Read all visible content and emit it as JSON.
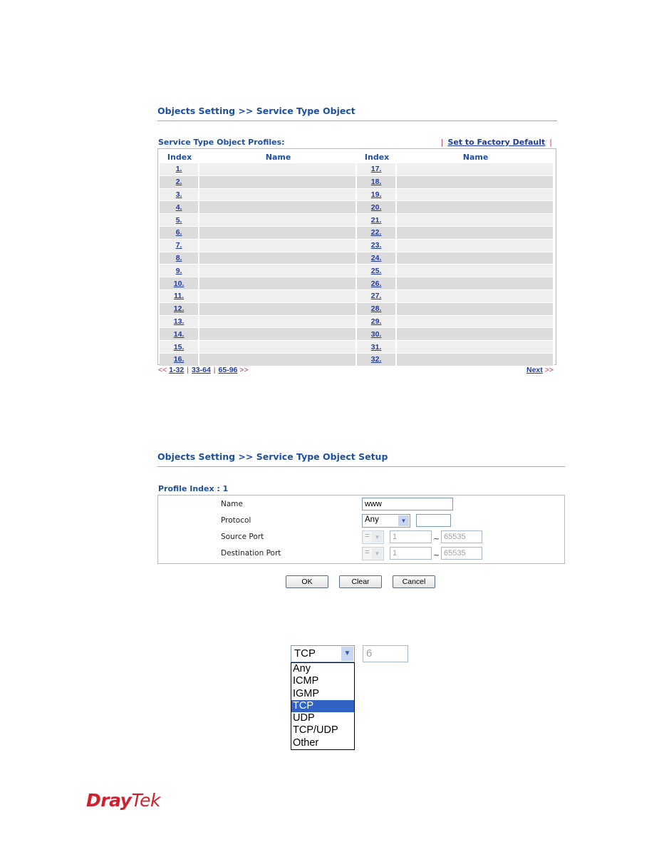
{
  "profiles_page": {
    "title": "Objects Setting >> Service Type Object",
    "subtitle": "Service Type Object Profiles:",
    "factory_default_label": "Set to Factory Default",
    "headers": {
      "index": "Index",
      "name": "Name"
    },
    "rows": [
      {
        "left": {
          "index": "1.",
          "name": ""
        },
        "right": {
          "index": "17.",
          "name": ""
        }
      },
      {
        "left": {
          "index": "2.",
          "name": ""
        },
        "right": {
          "index": "18.",
          "name": ""
        }
      },
      {
        "left": {
          "index": "3.",
          "name": ""
        },
        "right": {
          "index": "19.",
          "name": ""
        }
      },
      {
        "left": {
          "index": "4.",
          "name": ""
        },
        "right": {
          "index": "20.",
          "name": ""
        }
      },
      {
        "left": {
          "index": "5.",
          "name": ""
        },
        "right": {
          "index": "21.",
          "name": ""
        }
      },
      {
        "left": {
          "index": "6.",
          "name": ""
        },
        "right": {
          "index": "22.",
          "name": ""
        }
      },
      {
        "left": {
          "index": "7.",
          "name": ""
        },
        "right": {
          "index": "23.",
          "name": ""
        }
      },
      {
        "left": {
          "index": "8.",
          "name": ""
        },
        "right": {
          "index": "24.",
          "name": ""
        }
      },
      {
        "left": {
          "index": "9.",
          "name": ""
        },
        "right": {
          "index": "25.",
          "name": ""
        }
      },
      {
        "left": {
          "index": "10.",
          "name": ""
        },
        "right": {
          "index": "26.",
          "name": ""
        }
      },
      {
        "left": {
          "index": "11.",
          "name": ""
        },
        "right": {
          "index": "27.",
          "name": ""
        }
      },
      {
        "left": {
          "index": "12.",
          "name": ""
        },
        "right": {
          "index": "28.",
          "name": ""
        }
      },
      {
        "left": {
          "index": "13.",
          "name": ""
        },
        "right": {
          "index": "29.",
          "name": ""
        }
      },
      {
        "left": {
          "index": "14.",
          "name": ""
        },
        "right": {
          "index": "30.",
          "name": ""
        }
      },
      {
        "left": {
          "index": "15.",
          "name": ""
        },
        "right": {
          "index": "31.",
          "name": ""
        }
      },
      {
        "left": {
          "index": "16.",
          "name": ""
        },
        "right": {
          "index": "32.",
          "name": ""
        }
      }
    ],
    "pager": {
      "prev_arrows": "<<",
      "pages": [
        "1-32",
        "33-64",
        "65-96"
      ],
      "next_arrows": ">>",
      "next_label": "Next",
      "separator": "|"
    }
  },
  "setup_page": {
    "title": "Objects Setting >> Service Type Object Setup",
    "profile_index_label": "Profile Index : 1",
    "fields": {
      "name_label": "Name",
      "name_value": "www",
      "protocol_label": "Protocol",
      "protocol_value": "Any",
      "protocol_number": "",
      "source_port_label": "Source Port",
      "source_op": "=",
      "source_start": "1",
      "source_end": "65535",
      "dest_port_label": "Destination Port",
      "dest_op": "=",
      "dest_start": "1",
      "dest_end": "65535",
      "range_sep": "~"
    },
    "buttons": {
      "ok": "OK",
      "clear": "Clear",
      "cancel": "Cancel"
    }
  },
  "protocol_dropdown_demo": {
    "selected": "TCP",
    "protocol_number": "6",
    "options": [
      "Any",
      "ICMP",
      "IGMP",
      "TCP",
      "UDP",
      "TCP/UDP",
      "Other"
    ],
    "highlighted_index": 3
  },
  "brand": {
    "logo_part1": "Dray",
    "logo_part2": "Tek",
    "color": "#d11f2c"
  },
  "icons": {
    "dropdown_arrow": "chevron-down-icon"
  }
}
